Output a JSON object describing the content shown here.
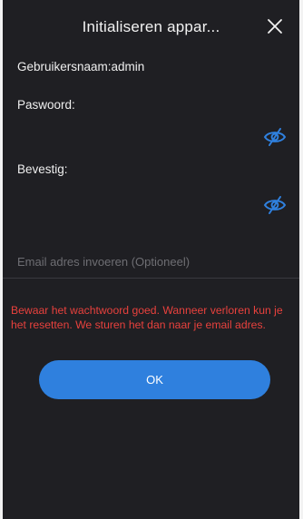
{
  "header": {
    "title": "Initialiseren appar...",
    "close_icon": "close-icon"
  },
  "form": {
    "username_label": "Gebruikersnaam:admin",
    "password_label": "Paswoord:",
    "password_value": "",
    "confirm_label": "Bevestig:",
    "confirm_value": "",
    "visibility_icon": "eye-off-icon",
    "email_placeholder": "Email adres invoeren (Optioneel)",
    "email_value": ""
  },
  "warning": "Bewaar het wachtwoord goed. Wanneer verloren kun je het resetten. We sturen het dan naar je email adres.",
  "ok_button": "OK",
  "colors": {
    "background": "#1f1f23",
    "accent": "#2f80de",
    "warning": "#e8413d",
    "eye_icon": "#2f80de"
  }
}
